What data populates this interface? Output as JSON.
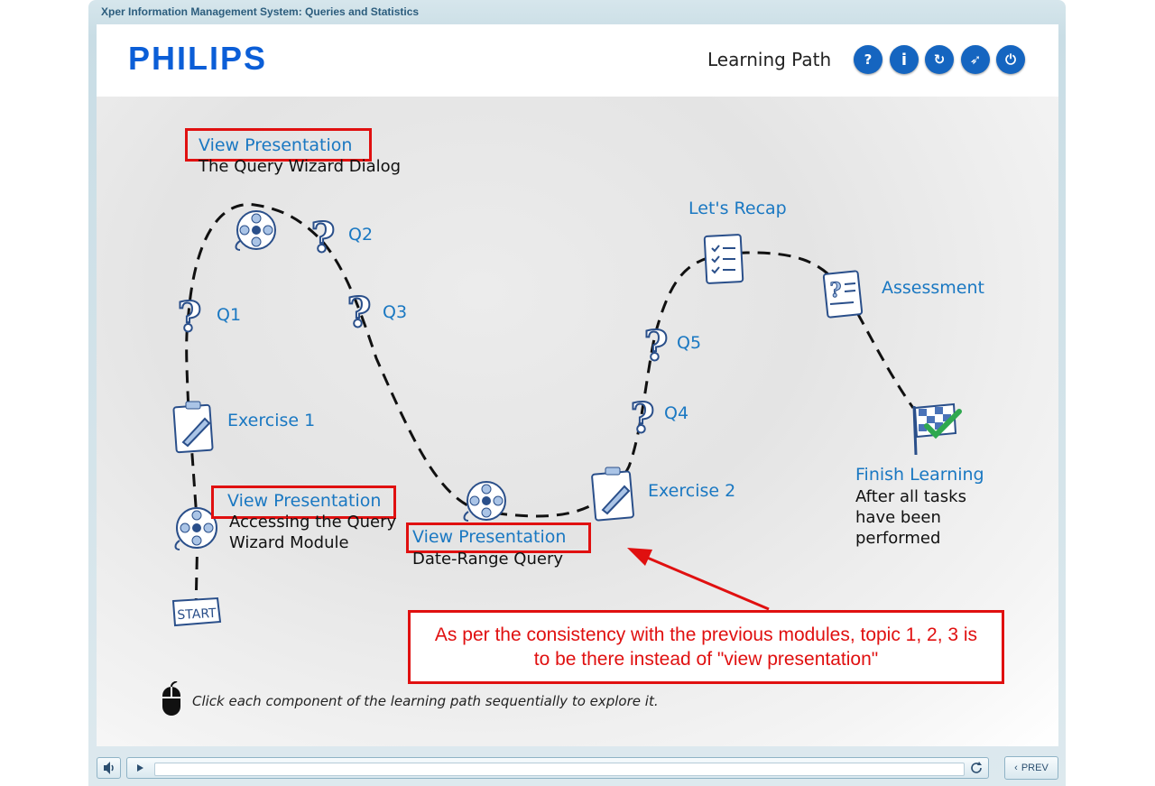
{
  "window": {
    "title": "Xper Information Management System: Queries and Statistics"
  },
  "header": {
    "brand": "PHILIPS",
    "title": "Learning Path",
    "buttons": [
      {
        "icon": "help-icon",
        "glyph": "?"
      },
      {
        "icon": "info-icon",
        "glyph": "i"
      },
      {
        "icon": "refresh-icon",
        "glyph": "↻"
      },
      {
        "icon": "compass-icon",
        "glyph": "➶"
      },
      {
        "icon": "power-icon",
        "glyph": "⏻"
      }
    ]
  },
  "path": {
    "start_label": "START",
    "presentation1": {
      "link": "View Presentation",
      "desc1": "Accessing the Query",
      "desc2": "Wizard Module"
    },
    "exercise1": "Exercise 1",
    "q1": "Q1",
    "presentation2": {
      "link": "View Presentation",
      "desc": "The Query Wizard Dialog"
    },
    "q2": "Q2",
    "q3": "Q3",
    "presentation3": {
      "link": "View Presentation",
      "desc": "Date-Range Query"
    },
    "exercise2": "Exercise 2",
    "q4": "Q4",
    "q5": "Q5",
    "recap": "Let's Recap",
    "assessment": "Assessment",
    "finish": {
      "link": "Finish Learning",
      "desc1": "After all tasks",
      "desc2": "have been",
      "desc3": "performed"
    }
  },
  "annotation": {
    "text": "As per the consistency with the previous modules, topic 1, 2, 3 is to be there instead of \"view presentation\""
  },
  "instruction": "Click each component of the learning path sequentially to explore it.",
  "player": {
    "prev_label": "PREV"
  },
  "colors": {
    "accent": "#1a78c2",
    "annotation": "#e01010",
    "button": "#1565c0"
  }
}
